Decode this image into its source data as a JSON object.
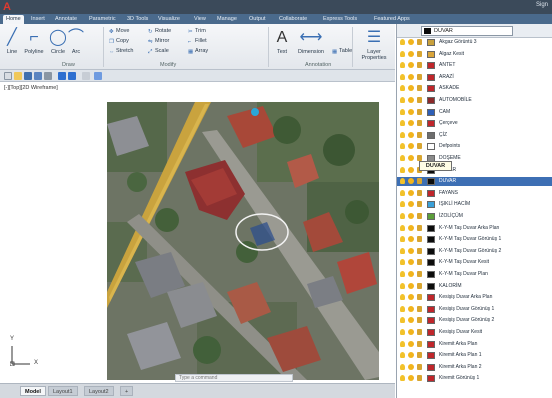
{
  "title_bar": {
    "logo": "A",
    "right_text": "Sign"
  },
  "tabs": [
    "Home",
    "Insert",
    "Annotate",
    "Parametric",
    "3D Tools",
    "Visualize",
    "View",
    "Manage",
    "Output",
    "Collaborate",
    "Express Tools",
    "Featured Apps"
  ],
  "ribbon": {
    "draw_tools": [
      "Line",
      "Polyline",
      "Circle",
      "Arc"
    ],
    "modify_tools": [
      "Move",
      "Rotate",
      "Trim",
      "Copy",
      "Mirror",
      "Fillet",
      "Stretch",
      "Scale",
      "Array"
    ],
    "annotation_tools": [
      "Text",
      "Dimension"
    ],
    "layer_tool": "Layer Properties",
    "table_label": "Table",
    "panels": [
      "Draw",
      "Modify",
      "Annotation"
    ]
  },
  "viewport_label": "[-][Top][2D Wireframe]",
  "command_placeholder": "Type a command",
  "bottom_tabs": [
    "Model",
    "Layout1",
    "Layout2",
    "+"
  ],
  "layer_panel": {
    "current": "DUVAR",
    "tooltip": "DUVAR",
    "layers": [
      {
        "name": "Akgaz Görüntü 3",
        "color": "#c8a03c"
      },
      {
        "name": "Algaz Kesit",
        "color": "#d9a43a"
      },
      {
        "name": "ANTET",
        "color": "#c0262b"
      },
      {
        "name": "ARAZİ",
        "color": "#c0262b"
      },
      {
        "name": "ASKADE",
        "color": "#c0262b"
      },
      {
        "name": "AUTOMOBİLE",
        "color": "#8c2a2a"
      },
      {
        "name": "CAM",
        "color": "#2e5fb7"
      },
      {
        "name": "Çerçeve",
        "color": "#c0262b"
      },
      {
        "name": "ÇİZ",
        "color": "#6d6d6d"
      },
      {
        "name": "Defpoints",
        "color": "#ffffff"
      },
      {
        "name": "DOŞEME",
        "color": "#8a8a8a"
      },
      {
        "name": "DUVAR",
        "color": "#0c0c0c"
      },
      {
        "name": "DUVAR",
        "color": "#0c0c0c"
      },
      {
        "name": "FAYANS",
        "color": "#c0262b"
      },
      {
        "name": "IŞIKLİ HACİM",
        "color": "#3aa0d8"
      },
      {
        "name": "İZOLİÇÜM",
        "color": "#5b9e3a"
      },
      {
        "name": "K-Y-M Taş Duvar Arka Plan",
        "color": "#0c0c0c"
      },
      {
        "name": "K-Y-M Taş Duvar Görünüş 1",
        "color": "#0c0c0c"
      },
      {
        "name": "K-Y-M Taş Duvar Görünüş 2",
        "color": "#0c0c0c"
      },
      {
        "name": "K-Y-M Taş Duvar Kesit",
        "color": "#0c0c0c"
      },
      {
        "name": "K-Y-M Taş Duvar Plan",
        "color": "#0c0c0c"
      },
      {
        "name": "KALORİM",
        "color": "#0c0c0c"
      },
      {
        "name": "Kesişiş Duvar Arka Plan",
        "color": "#c0262b"
      },
      {
        "name": "Kesişiş Duvar Görünüş 1",
        "color": "#c0262b"
      },
      {
        "name": "Kesişiş Duvar Görünüş 2",
        "color": "#c0262b"
      },
      {
        "name": "Kesişiş Duvar Kesit",
        "color": "#c0262b"
      },
      {
        "name": "Kiremit Arka Plan",
        "color": "#c0262b"
      },
      {
        "name": "Kiremit Arka Plan 1",
        "color": "#c0262b"
      },
      {
        "name": "Kiremit Arka Plan 2",
        "color": "#c0262b"
      },
      {
        "name": "Kiremit Görünüş 1",
        "color": "#c0262b"
      }
    ]
  }
}
